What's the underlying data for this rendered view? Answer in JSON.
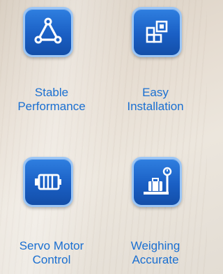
{
  "features": [
    {
      "label_line1": "Stable",
      "label_line2": "Performance",
      "icon": "triangle-network-icon"
    },
    {
      "label_line1": "Easy",
      "label_line2": "Installation",
      "icon": "grid-blocks-icon"
    },
    {
      "label_line1": "Servo Motor",
      "label_line2": "Control",
      "icon": "motor-icon"
    },
    {
      "label_line1": "Weighing",
      "label_line2": "Accurate",
      "icon": "weighing-scale-icon"
    }
  ],
  "colors": {
    "accent": "#1a6fd1",
    "tile": "#1a5fc4",
    "tile_border": "#9cc6f5"
  }
}
